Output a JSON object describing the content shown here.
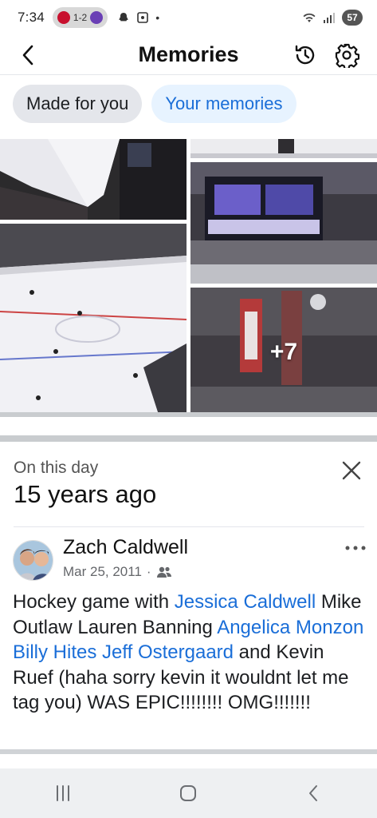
{
  "status_bar": {
    "time": "7:34",
    "score": "1-2",
    "battery": "57"
  },
  "header": {
    "title": "Memories"
  },
  "tabs": [
    {
      "label": "Made for you"
    },
    {
      "label": "Your memories"
    }
  ],
  "photos": {
    "more_count": "+7"
  },
  "on_this_day": {
    "label": "On this day",
    "years_ago": "15 years ago"
  },
  "post": {
    "author": "Zach Caldwell",
    "date": "Mar 25, 2011",
    "separator": "·",
    "text_segments": [
      {
        "text": "Hockey game with ",
        "tag": false
      },
      {
        "text": "Jessica Caldwell",
        "tag": true
      },
      {
        "text": " Mike Outlaw Lauren Banning ",
        "tag": false
      },
      {
        "text": "Angelica Monzon",
        "tag": true
      },
      {
        "text": " ",
        "tag": false
      },
      {
        "text": "Billy Hites",
        "tag": true
      },
      {
        "text": " ",
        "tag": false
      },
      {
        "text": "Jeff Ostergaard",
        "tag": true
      },
      {
        "text": " and Kevin Ruef (haha sorry kevin it wouldnt let me tag you) WAS EPIC!!!!!!!! OMG!!!!!!!",
        "tag": false
      }
    ]
  },
  "colors": {
    "link_blue": "#1a6ed8",
    "tab_active_bg": "#e4e6eb",
    "tab_secondary_bg": "#e7f3ff"
  }
}
